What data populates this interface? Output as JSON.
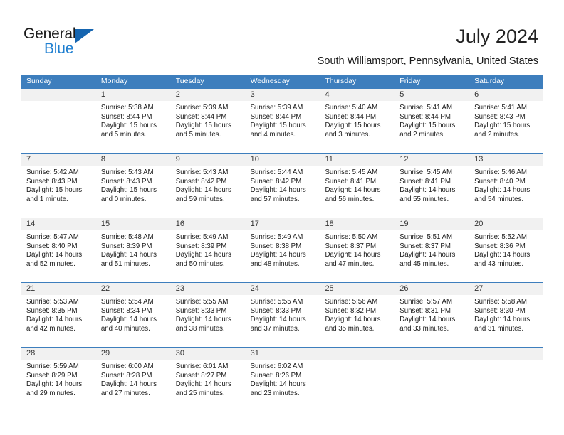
{
  "brand": {
    "name_part1": "General",
    "name_part2": "Blue",
    "triangle_color": "#1565b0",
    "blue_color": "#1f7fd0"
  },
  "header": {
    "title": "July 2024",
    "location": "South Williamsport, Pennsylvania, United States"
  },
  "theme": {
    "header_row_bg": "#3d7ebd",
    "day_band_bg": "#f1f1f1",
    "border_color": "#3d7ebd"
  },
  "weekdays": [
    "Sunday",
    "Monday",
    "Tuesday",
    "Wednesday",
    "Thursday",
    "Friday",
    "Saturday"
  ],
  "weeks": [
    [
      {
        "day": "",
        "sunrise": "",
        "sunset": "",
        "daylight_line1": "",
        "daylight_line2": ""
      },
      {
        "day": "1",
        "sunrise": "Sunrise: 5:38 AM",
        "sunset": "Sunset: 8:44 PM",
        "daylight_line1": "Daylight: 15 hours",
        "daylight_line2": "and 5 minutes."
      },
      {
        "day": "2",
        "sunrise": "Sunrise: 5:39 AM",
        "sunset": "Sunset: 8:44 PM",
        "daylight_line1": "Daylight: 15 hours",
        "daylight_line2": "and 5 minutes."
      },
      {
        "day": "3",
        "sunrise": "Sunrise: 5:39 AM",
        "sunset": "Sunset: 8:44 PM",
        "daylight_line1": "Daylight: 15 hours",
        "daylight_line2": "and 4 minutes."
      },
      {
        "day": "4",
        "sunrise": "Sunrise: 5:40 AM",
        "sunset": "Sunset: 8:44 PM",
        "daylight_line1": "Daylight: 15 hours",
        "daylight_line2": "and 3 minutes."
      },
      {
        "day": "5",
        "sunrise": "Sunrise: 5:41 AM",
        "sunset": "Sunset: 8:44 PM",
        "daylight_line1": "Daylight: 15 hours",
        "daylight_line2": "and 2 minutes."
      },
      {
        "day": "6",
        "sunrise": "Sunrise: 5:41 AM",
        "sunset": "Sunset: 8:43 PM",
        "daylight_line1": "Daylight: 15 hours",
        "daylight_line2": "and 2 minutes."
      }
    ],
    [
      {
        "day": "7",
        "sunrise": "Sunrise: 5:42 AM",
        "sunset": "Sunset: 8:43 PM",
        "daylight_line1": "Daylight: 15 hours",
        "daylight_line2": "and 1 minute."
      },
      {
        "day": "8",
        "sunrise": "Sunrise: 5:43 AM",
        "sunset": "Sunset: 8:43 PM",
        "daylight_line1": "Daylight: 15 hours",
        "daylight_line2": "and 0 minutes."
      },
      {
        "day": "9",
        "sunrise": "Sunrise: 5:43 AM",
        "sunset": "Sunset: 8:42 PM",
        "daylight_line1": "Daylight: 14 hours",
        "daylight_line2": "and 59 minutes."
      },
      {
        "day": "10",
        "sunrise": "Sunrise: 5:44 AM",
        "sunset": "Sunset: 8:42 PM",
        "daylight_line1": "Daylight: 14 hours",
        "daylight_line2": "and 57 minutes."
      },
      {
        "day": "11",
        "sunrise": "Sunrise: 5:45 AM",
        "sunset": "Sunset: 8:41 PM",
        "daylight_line1": "Daylight: 14 hours",
        "daylight_line2": "and 56 minutes."
      },
      {
        "day": "12",
        "sunrise": "Sunrise: 5:45 AM",
        "sunset": "Sunset: 8:41 PM",
        "daylight_line1": "Daylight: 14 hours",
        "daylight_line2": "and 55 minutes."
      },
      {
        "day": "13",
        "sunrise": "Sunrise: 5:46 AM",
        "sunset": "Sunset: 8:40 PM",
        "daylight_line1": "Daylight: 14 hours",
        "daylight_line2": "and 54 minutes."
      }
    ],
    [
      {
        "day": "14",
        "sunrise": "Sunrise: 5:47 AM",
        "sunset": "Sunset: 8:40 PM",
        "daylight_line1": "Daylight: 14 hours",
        "daylight_line2": "and 52 minutes."
      },
      {
        "day": "15",
        "sunrise": "Sunrise: 5:48 AM",
        "sunset": "Sunset: 8:39 PM",
        "daylight_line1": "Daylight: 14 hours",
        "daylight_line2": "and 51 minutes."
      },
      {
        "day": "16",
        "sunrise": "Sunrise: 5:49 AM",
        "sunset": "Sunset: 8:39 PM",
        "daylight_line1": "Daylight: 14 hours",
        "daylight_line2": "and 50 minutes."
      },
      {
        "day": "17",
        "sunrise": "Sunrise: 5:49 AM",
        "sunset": "Sunset: 8:38 PM",
        "daylight_line1": "Daylight: 14 hours",
        "daylight_line2": "and 48 minutes."
      },
      {
        "day": "18",
        "sunrise": "Sunrise: 5:50 AM",
        "sunset": "Sunset: 8:37 PM",
        "daylight_line1": "Daylight: 14 hours",
        "daylight_line2": "and 47 minutes."
      },
      {
        "day": "19",
        "sunrise": "Sunrise: 5:51 AM",
        "sunset": "Sunset: 8:37 PM",
        "daylight_line1": "Daylight: 14 hours",
        "daylight_line2": "and 45 minutes."
      },
      {
        "day": "20",
        "sunrise": "Sunrise: 5:52 AM",
        "sunset": "Sunset: 8:36 PM",
        "daylight_line1": "Daylight: 14 hours",
        "daylight_line2": "and 43 minutes."
      }
    ],
    [
      {
        "day": "21",
        "sunrise": "Sunrise: 5:53 AM",
        "sunset": "Sunset: 8:35 PM",
        "daylight_line1": "Daylight: 14 hours",
        "daylight_line2": "and 42 minutes."
      },
      {
        "day": "22",
        "sunrise": "Sunrise: 5:54 AM",
        "sunset": "Sunset: 8:34 PM",
        "daylight_line1": "Daylight: 14 hours",
        "daylight_line2": "and 40 minutes."
      },
      {
        "day": "23",
        "sunrise": "Sunrise: 5:55 AM",
        "sunset": "Sunset: 8:33 PM",
        "daylight_line1": "Daylight: 14 hours",
        "daylight_line2": "and 38 minutes."
      },
      {
        "day": "24",
        "sunrise": "Sunrise: 5:55 AM",
        "sunset": "Sunset: 8:33 PM",
        "daylight_line1": "Daylight: 14 hours",
        "daylight_line2": "and 37 minutes."
      },
      {
        "day": "25",
        "sunrise": "Sunrise: 5:56 AM",
        "sunset": "Sunset: 8:32 PM",
        "daylight_line1": "Daylight: 14 hours",
        "daylight_line2": "and 35 minutes."
      },
      {
        "day": "26",
        "sunrise": "Sunrise: 5:57 AM",
        "sunset": "Sunset: 8:31 PM",
        "daylight_line1": "Daylight: 14 hours",
        "daylight_line2": "and 33 minutes."
      },
      {
        "day": "27",
        "sunrise": "Sunrise: 5:58 AM",
        "sunset": "Sunset: 8:30 PM",
        "daylight_line1": "Daylight: 14 hours",
        "daylight_line2": "and 31 minutes."
      }
    ],
    [
      {
        "day": "28",
        "sunrise": "Sunrise: 5:59 AM",
        "sunset": "Sunset: 8:29 PM",
        "daylight_line1": "Daylight: 14 hours",
        "daylight_line2": "and 29 minutes."
      },
      {
        "day": "29",
        "sunrise": "Sunrise: 6:00 AM",
        "sunset": "Sunset: 8:28 PM",
        "daylight_line1": "Daylight: 14 hours",
        "daylight_line2": "and 27 minutes."
      },
      {
        "day": "30",
        "sunrise": "Sunrise: 6:01 AM",
        "sunset": "Sunset: 8:27 PM",
        "daylight_line1": "Daylight: 14 hours",
        "daylight_line2": "and 25 minutes."
      },
      {
        "day": "31",
        "sunrise": "Sunrise: 6:02 AM",
        "sunset": "Sunset: 8:26 PM",
        "daylight_line1": "Daylight: 14 hours",
        "daylight_line2": "and 23 minutes."
      },
      {
        "day": "",
        "sunrise": "",
        "sunset": "",
        "daylight_line1": "",
        "daylight_line2": ""
      },
      {
        "day": "",
        "sunrise": "",
        "sunset": "",
        "daylight_line1": "",
        "daylight_line2": ""
      },
      {
        "day": "",
        "sunrise": "",
        "sunset": "",
        "daylight_line1": "",
        "daylight_line2": ""
      }
    ]
  ]
}
